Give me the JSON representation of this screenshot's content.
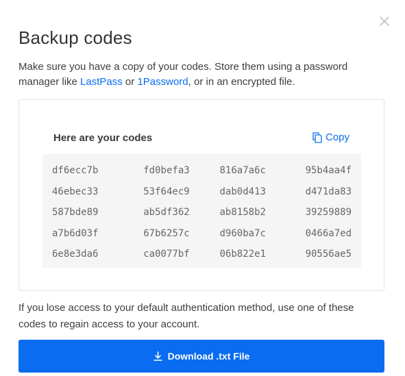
{
  "dialog": {
    "title": "Backup codes",
    "intro_before": "Make sure you have a copy of your codes. Store them using a password manager like ",
    "link_lastpass": "LastPass",
    "intro_or": " or ",
    "link_1password": "1Password",
    "intro_after": ", or in an encrypted file.",
    "codes_header": "Here are your codes",
    "copy_label": "Copy",
    "codes": [
      "df6ecc7b",
      "fd0befa3",
      "816a7a6c",
      "95b4aa4f",
      "46ebec33",
      "53f64ec9",
      "dab0d413",
      "d471da83",
      "587bde89",
      "ab5df362",
      "ab8158b2",
      "39259889",
      "a7b6d03f",
      "67b6257c",
      "d960ba7c",
      "0466a7ed",
      "6e8e3da6",
      "ca0077bf",
      "06b822e1",
      "90556ae5"
    ],
    "footer_text": "If you lose access to your default authentication method, use one of these codes to regain access to your account.",
    "download_label": "Download .txt File",
    "icons": {
      "close": "close-icon",
      "copy": "copy-icon",
      "download": "download-icon"
    },
    "colors": {
      "accent": "#0a6cf0",
      "code_bg": "#f5f5f5"
    }
  }
}
